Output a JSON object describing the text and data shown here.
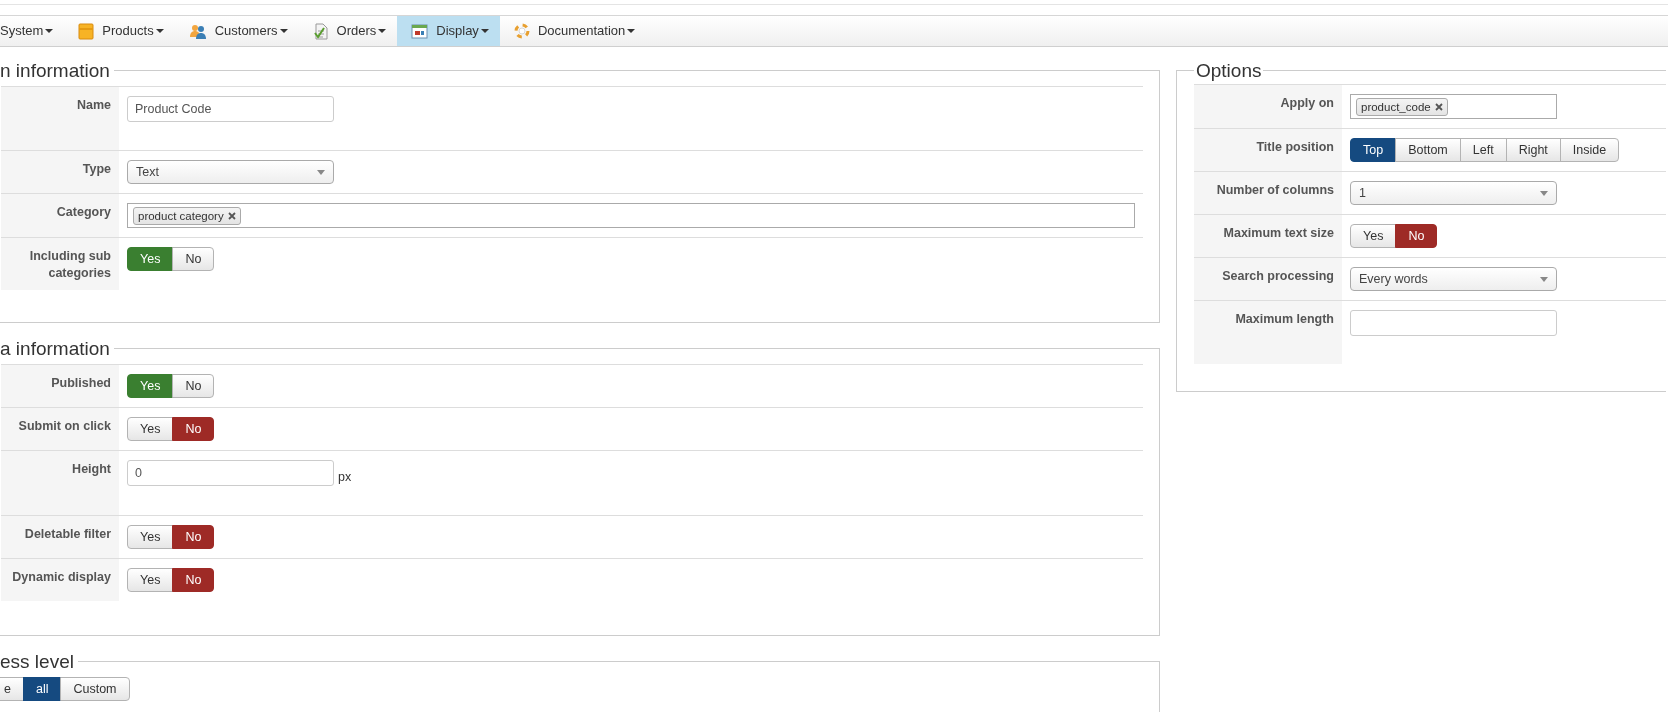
{
  "menu": [
    {
      "label": "System",
      "kind": "none",
      "selected": false
    },
    {
      "label": "Products",
      "kind": "box",
      "selected": false
    },
    {
      "label": "Customers",
      "kind": "people",
      "selected": false
    },
    {
      "label": "Orders",
      "kind": "document",
      "selected": false
    },
    {
      "label": "Display",
      "kind": "window",
      "selected": true
    },
    {
      "label": "Documentation",
      "kind": "lifebuoy",
      "selected": false
    }
  ],
  "sections": [
    {
      "title": "n information",
      "rows": [
        {
          "label": "Name",
          "kind": "text",
          "value": "Product Code"
        },
        {
          "label": "Type",
          "kind": "select",
          "value": "Text"
        },
        {
          "label": "Category",
          "kind": "tags",
          "tags": [
            "product category"
          ]
        },
        {
          "label": "Including sub categories",
          "kind": "toggle",
          "options": [
            {
              "label": "Yes",
              "kind": "yes",
              "selected": true
            },
            {
              "label": "No",
              "kind": "no",
              "selected": false
            }
          ]
        }
      ]
    },
    {
      "title": "a information",
      "rows": [
        {
          "label": "Published",
          "kind": "toggle",
          "options": [
            {
              "label": "Yes",
              "kind": "yes",
              "selected": true
            },
            {
              "label": "No",
              "kind": "no",
              "selected": false
            }
          ]
        },
        {
          "label": "Submit on click",
          "kind": "toggle",
          "options": [
            {
              "label": "Yes",
              "kind": "yes",
              "selected": false
            },
            {
              "label": "No",
              "kind": "no",
              "selected": true
            }
          ]
        },
        {
          "label": "Height",
          "kind": "text",
          "value": "0",
          "suffix": "px"
        },
        {
          "label": "Deletable filter",
          "kind": "toggle",
          "options": [
            {
              "label": "Yes",
              "kind": "yes",
              "selected": false
            },
            {
              "label": "No",
              "kind": "no",
              "selected": true
            }
          ]
        },
        {
          "label": "Dynamic display",
          "kind": "toggle",
          "options": [
            {
              "label": "Yes",
              "kind": "yes",
              "selected": false
            },
            {
              "label": "No",
              "kind": "no",
              "selected": true
            }
          ]
        }
      ]
    }
  ],
  "access": {
    "title": "ess level",
    "options": [
      {
        "label": "e",
        "kind": "choice",
        "selected": false
      },
      {
        "label": "all",
        "kind": "choice",
        "selected": true
      },
      {
        "label": "Custom",
        "kind": "choice",
        "selected": false
      }
    ]
  },
  "options_panel": {
    "title": "Options",
    "rows": [
      {
        "label": "Apply on",
        "kind": "tags",
        "tags": [
          "product_code"
        ]
      },
      {
        "label": "Title position",
        "kind": "toggle",
        "options": [
          {
            "label": "Top",
            "kind": "choice",
            "selected": true
          },
          {
            "label": "Bottom",
            "kind": "choice",
            "selected": false
          },
          {
            "label": "Left",
            "kind": "choice",
            "selected": false
          },
          {
            "label": "Right",
            "kind": "choice",
            "selected": false
          },
          {
            "label": "Inside",
            "kind": "choice",
            "selected": false
          }
        ]
      },
      {
        "label": "Number of columns",
        "kind": "select",
        "value": "1"
      },
      {
        "label": "Maximum text size",
        "kind": "toggle",
        "options": [
          {
            "label": "Yes",
            "kind": "yes",
            "selected": false
          },
          {
            "label": "No",
            "kind": "no",
            "selected": true
          }
        ]
      },
      {
        "label": "Search processing",
        "kind": "select",
        "value": "Every words"
      },
      {
        "label": "Maximum length",
        "kind": "text",
        "value": ""
      }
    ]
  }
}
